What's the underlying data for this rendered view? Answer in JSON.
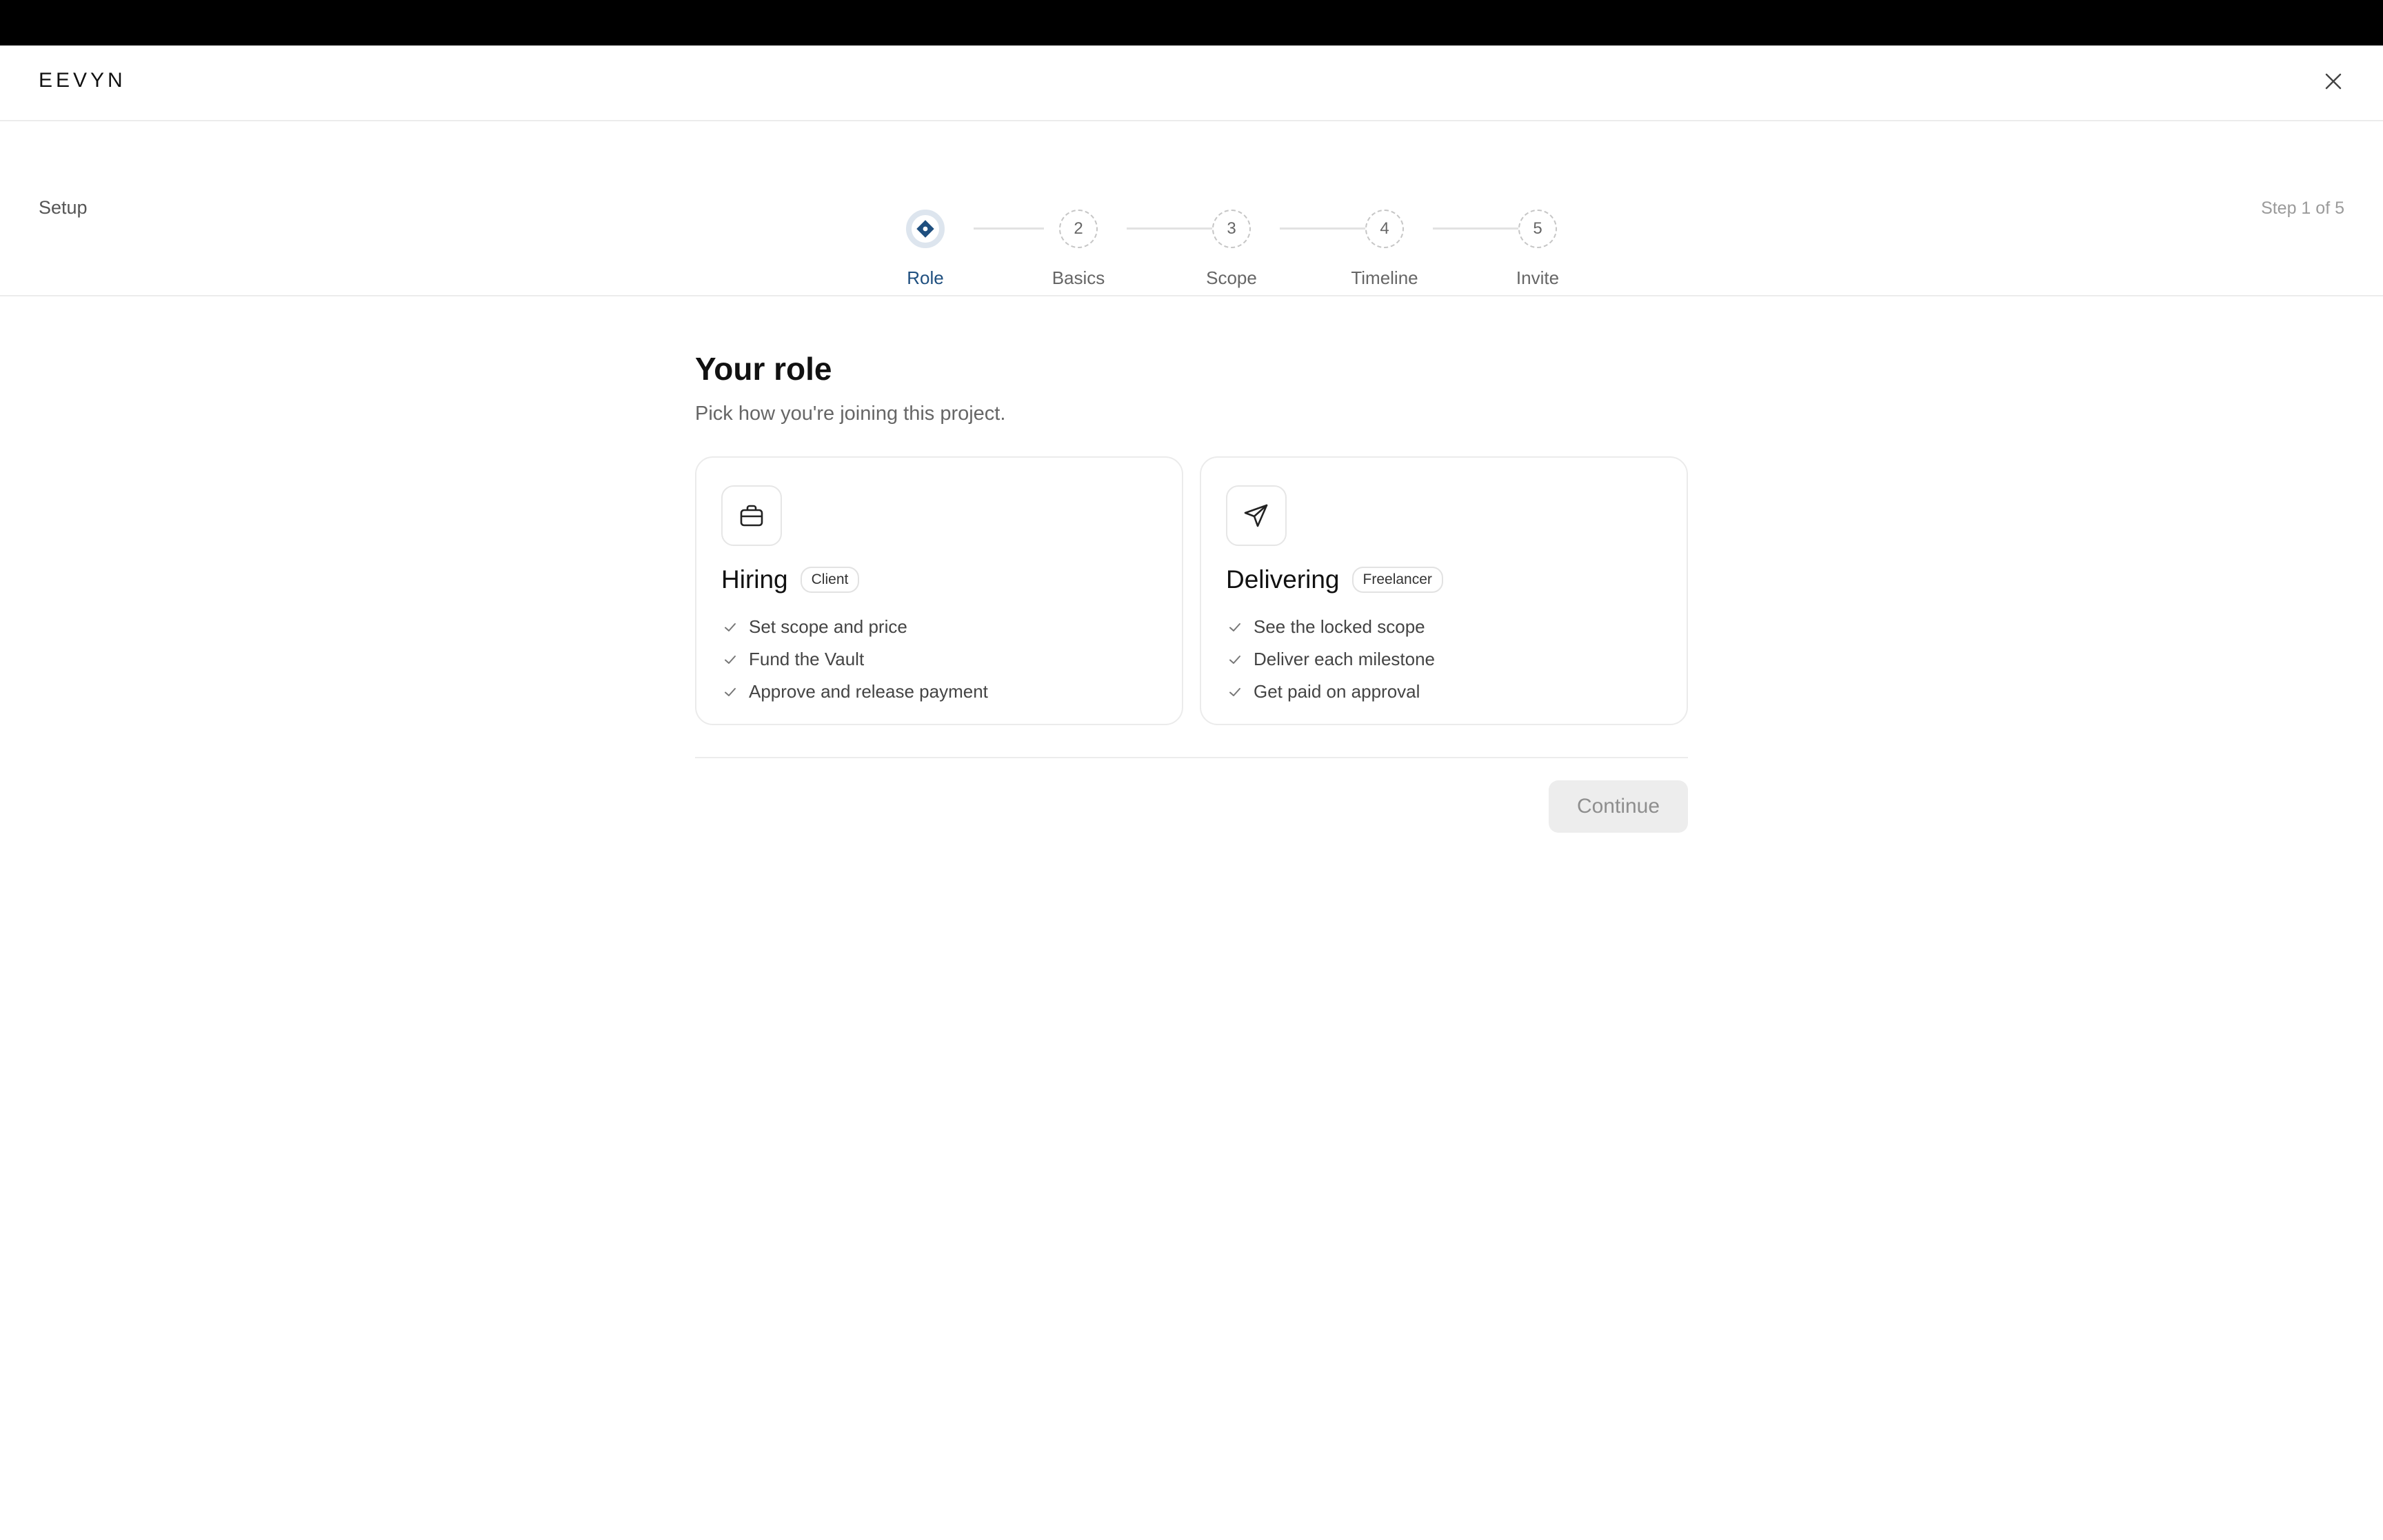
{
  "header": {
    "brand": "EEVYN"
  },
  "setup": {
    "label": "Setup",
    "step_count": "Step 1 of 5",
    "steps": [
      {
        "number": "",
        "label": "Role",
        "state": "active"
      },
      {
        "number": "2",
        "label": "Basics",
        "state": "pending"
      },
      {
        "number": "3",
        "label": "Scope",
        "state": "pending"
      },
      {
        "number": "4",
        "label": "Timeline",
        "state": "pending"
      },
      {
        "number": "5",
        "label": "Invite",
        "state": "pending"
      }
    ]
  },
  "main": {
    "title": "Your role",
    "subtitle": "Pick how you're joining this project.",
    "cards": [
      {
        "icon": "briefcase-icon",
        "title": "Hiring",
        "badge": "Client",
        "features": [
          "Set scope and price",
          "Fund the Vault",
          "Approve and release payment"
        ]
      },
      {
        "icon": "paper-plane-icon",
        "title": "Delivering",
        "badge": "Freelancer",
        "features": [
          "See the locked scope",
          "Deliver each milestone",
          "Get paid on approval"
        ]
      }
    ],
    "continue_label": "Continue"
  },
  "colors": {
    "accent": "#1f4f7f",
    "active_ring": "#dde5ee",
    "border": "#ebebeb",
    "disabled_button_bg": "#ededed",
    "disabled_button_text": "#8e8e8e"
  }
}
